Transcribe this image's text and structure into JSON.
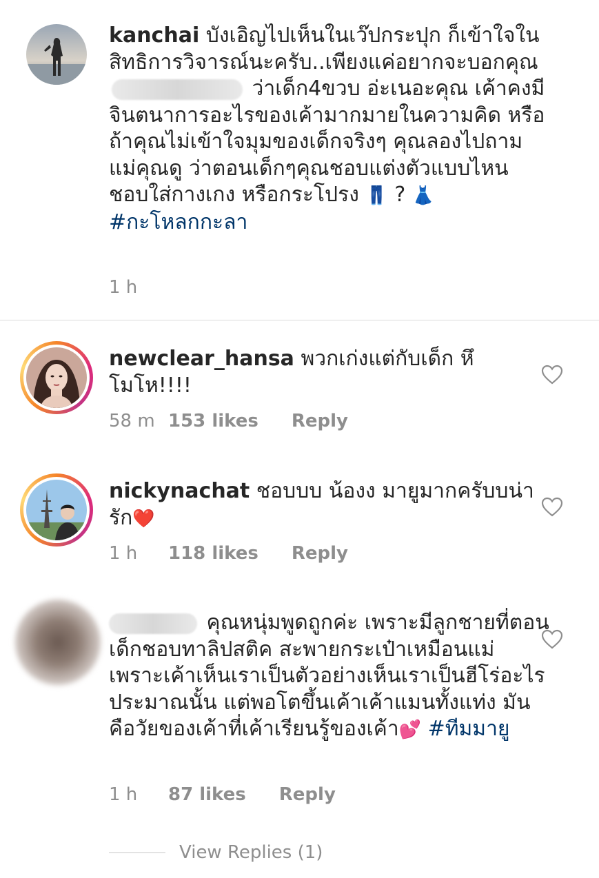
{
  "caption": {
    "username": "kanchai",
    "text_before_redaction": " บังเอิญไปเห็นในเว๊ปกระปุก ก็เข้าใจในสิทธิการวิจารณ์นะครับ..เพียงแค่อยากจะบอกคุณ",
    "text_after_redaction": " ว่าเด็ก4ขวบ อ่ะเนอะคุณ เค้าคงมีจินตนาการอะไรของเค้ามากมายในความคิด หรือถ้าคุณไม่เข้าใจมุมของเด็กจริงๆ คุณลองไปถามแม่คุณดู ว่าตอนเด็กๆคุณชอบแต่งตัวแบบไหน ชอบใส่กางเกง หรือกระโปรง ",
    "emoji_jeans": "👖",
    "question": " ? ",
    "emoji_dress": "👗",
    "hashtag": "#กะโหลกกะลา",
    "time": "1 h"
  },
  "comments": [
    {
      "username": "newclear_hansa",
      "text": " พวกเก่งแต่กับเด็ก หึโมโห!!!!",
      "time": "58 m",
      "likes": "153 likes",
      "reply": "Reply"
    },
    {
      "username": "nickynachat",
      "text": " ชอบบบ น้องง มายูมากครับบน่ารัก",
      "emoji": "❤️",
      "time": "1 h",
      "likes": "118 likes",
      "reply": "Reply"
    },
    {
      "text": " คุณหนุ่มพูดถูกค่ะ เพราะมีลูกชายที่ตอนเด็กชอบทาลิปสติค สะพายกระเป๋าเหมือนแม่ เพราะเค้าเห็นเราเป็นตัวอย่างเห็นเราเป็นฮีโร่อะไรประมาณนั้น แต่พอโตขึ้นเค้าเค้าแมนทั้งแท่ง มันคือวัยของเค้าที่เค้าเรียนรู้ของเค้า",
      "emoji": "💕",
      "hashtag": " #ทีมมายู",
      "time": "1 h",
      "likes": "87 likes",
      "reply": "Reply"
    }
  ],
  "view_replies": "View Replies (1)"
}
